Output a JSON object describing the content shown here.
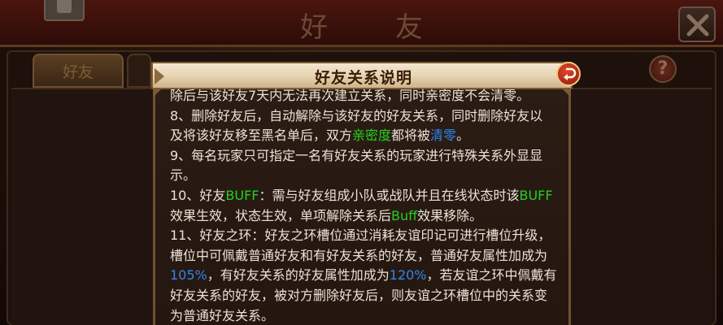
{
  "background": {
    "window_title": "好 友",
    "tab_friends": "好友",
    "help_label": "?"
  },
  "dialog": {
    "title": "好友关系说明",
    "lines": [
      [
        {
          "t": "除后与该好友7天内无法再次建立关系，同时亲密度不会清零。",
          "c": "w"
        }
      ],
      [
        {
          "t": "8、删除好友后，自动解除与该好友的好友关系，同时删除好友以",
          "c": "w"
        }
      ],
      [
        {
          "t": "及将该好友移至黑名单后，双方",
          "c": "w"
        },
        {
          "t": "亲密度",
          "c": "g"
        },
        {
          "t": "都将被",
          "c": "w"
        },
        {
          "t": "清零",
          "c": "b"
        },
        {
          "t": "。",
          "c": "w"
        }
      ],
      [
        {
          "t": "9、每名玩家只可指定一名有好友关系的玩家进行特殊关系外显显",
          "c": "w"
        }
      ],
      [
        {
          "t": "示。",
          "c": "w"
        }
      ],
      [
        {
          "t": "10、好友",
          "c": "w"
        },
        {
          "t": "BUFF",
          "c": "g"
        },
        {
          "t": "：需与好友组成小队或战队并且在线状态时该",
          "c": "w"
        },
        {
          "t": "BUFF",
          "c": "g"
        }
      ],
      [
        {
          "t": "效果生效，状态生效，单项解除关系后",
          "c": "w"
        },
        {
          "t": "Buff",
          "c": "g"
        },
        {
          "t": "效果移除。",
          "c": "w"
        }
      ],
      [
        {
          "t": "11、好友之环：好友之环槽位通过消耗友谊印记可进行槽位升级，",
          "c": "w"
        }
      ],
      [
        {
          "t": "槽位中可佩戴普通好友和有好友关系的好友，普通好友属性加成为",
          "c": "w"
        }
      ],
      [
        {
          "t": "105%",
          "c": "b"
        },
        {
          "t": "，有好友关系的好友属性加成为",
          "c": "w"
        },
        {
          "t": "120%",
          "c": "b"
        },
        {
          "t": "，若友谊之环中佩戴有",
          "c": "w"
        }
      ],
      [
        {
          "t": "好友关系的好友，被对方删除好友后，则友谊之环槽位中的关系变",
          "c": "w"
        }
      ],
      [
        {
          "t": "为普通好友关系。",
          "c": "w"
        }
      ]
    ]
  },
  "colors": {
    "text": "#ece2d4",
    "highlight_green": "#22d11e",
    "highlight_blue": "#2f86f0",
    "header_bg": "#e7d4b2"
  },
  "icons": {
    "close": "close-icon",
    "back": "back-arrow-icon",
    "help": "question-icon"
  }
}
